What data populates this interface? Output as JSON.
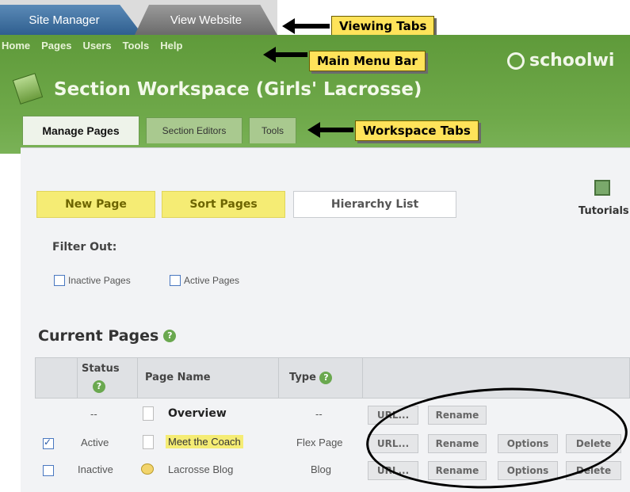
{
  "viewing_tabs": {
    "site_manager": "Site Manager",
    "view_website": "View Website"
  },
  "callouts": {
    "viewing_tabs": "Viewing Tabs",
    "main_menu_bar": "Main Menu Bar",
    "workspace_tabs": "Workspace Tabs"
  },
  "menu": [
    "Home",
    "Pages",
    "Users",
    "Tools",
    "Help"
  ],
  "workspace": {
    "title": "Section Workspace (Girls' Lacrosse)",
    "brand": "schoolwi"
  },
  "workspace_tabs": [
    "Manage Pages",
    "Section Editors",
    "Tools"
  ],
  "toolbar": {
    "new_page": "New Page",
    "sort_pages": "Sort Pages",
    "hierarchy_list": "Hierarchy List",
    "tutorials": "Tutorials"
  },
  "filter": {
    "label": "Filter Out:",
    "inactive": "Inactive Pages",
    "active": "Active Pages"
  },
  "current_pages": {
    "title": "Current Pages",
    "help_icon": "question-icon"
  },
  "table": {
    "headers": {
      "status": "Status",
      "page_name": "Page Name",
      "type": "Type"
    },
    "rows": [
      {
        "status": "--",
        "name": "Overview",
        "type": "--",
        "checked": false,
        "actions": [
          "URL...",
          "Rename"
        ]
      },
      {
        "status": "Active",
        "name": "Meet the Coach",
        "type": "Flex Page",
        "checked": true,
        "actions": [
          "URL...",
          "Rename",
          "Options",
          "Delete"
        ]
      },
      {
        "status": "Inactive",
        "name": "Lacrosse Blog",
        "type": "Blog",
        "checked": false,
        "actions": [
          "URL...",
          "Rename",
          "Options",
          "Delete"
        ]
      }
    ]
  },
  "colors": {
    "header_green": "#6fa94a",
    "highlight_yellow": "#f5ec74",
    "callout_yellow": "#ffe35a"
  }
}
